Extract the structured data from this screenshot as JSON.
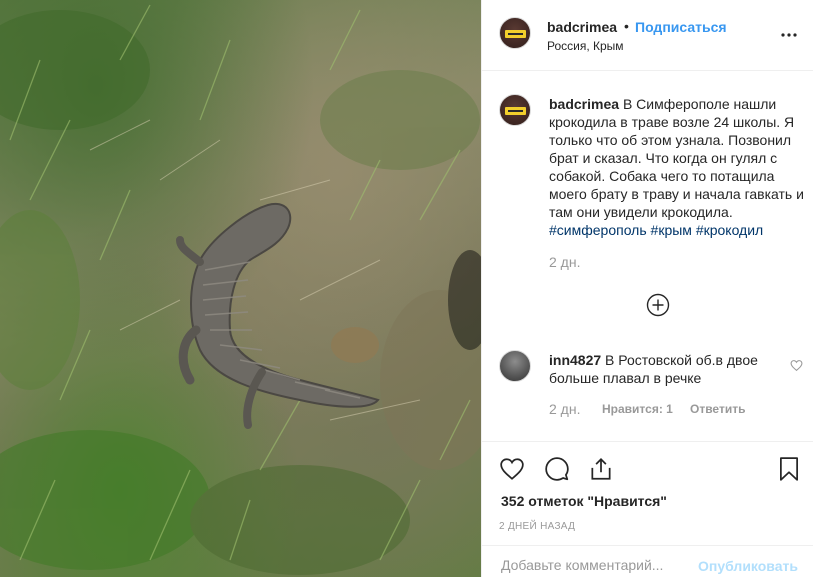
{
  "post": {
    "image_icon": "crocodile-photo",
    "header": {
      "username": "badcrimea",
      "separator": "•",
      "follow_label": "Подписаться",
      "location": "Россия, Крым",
      "more_icon": "more-horizontal-icon"
    },
    "caption": {
      "username": "badcrimea",
      "text": "В Симферополе нашли крокодила в траве возле 24 школы. Я только что об этом узнала. Позвонил брат и сказал. Что когда он гулял с собакой. Собака чего то потащила моего брату в траву и начала гавкать и там они увидели крокодила.",
      "hashtags": [
        "#симферополь",
        "#крым",
        "#крокодил"
      ],
      "time": "2 дн."
    },
    "load_more_icon": "plus-circle-icon",
    "comments": [
      {
        "username": "inn4827",
        "text": "В Ростовской об.в двое больше плавал в речке",
        "time": "2 дн.",
        "likes_label": "Нравится: 1",
        "reply_label": "Ответить"
      }
    ],
    "actions": {
      "like_icon": "heart-icon",
      "comment_icon": "comment-icon",
      "share_icon": "share-icon",
      "save_icon": "bookmark-icon"
    },
    "likes_text": "352 отметок \"Нравится\"",
    "date_text": "2 дней назад",
    "add_comment": {
      "placeholder": "Добавьте комментарий...",
      "publish_label": "Опубликовать"
    }
  }
}
